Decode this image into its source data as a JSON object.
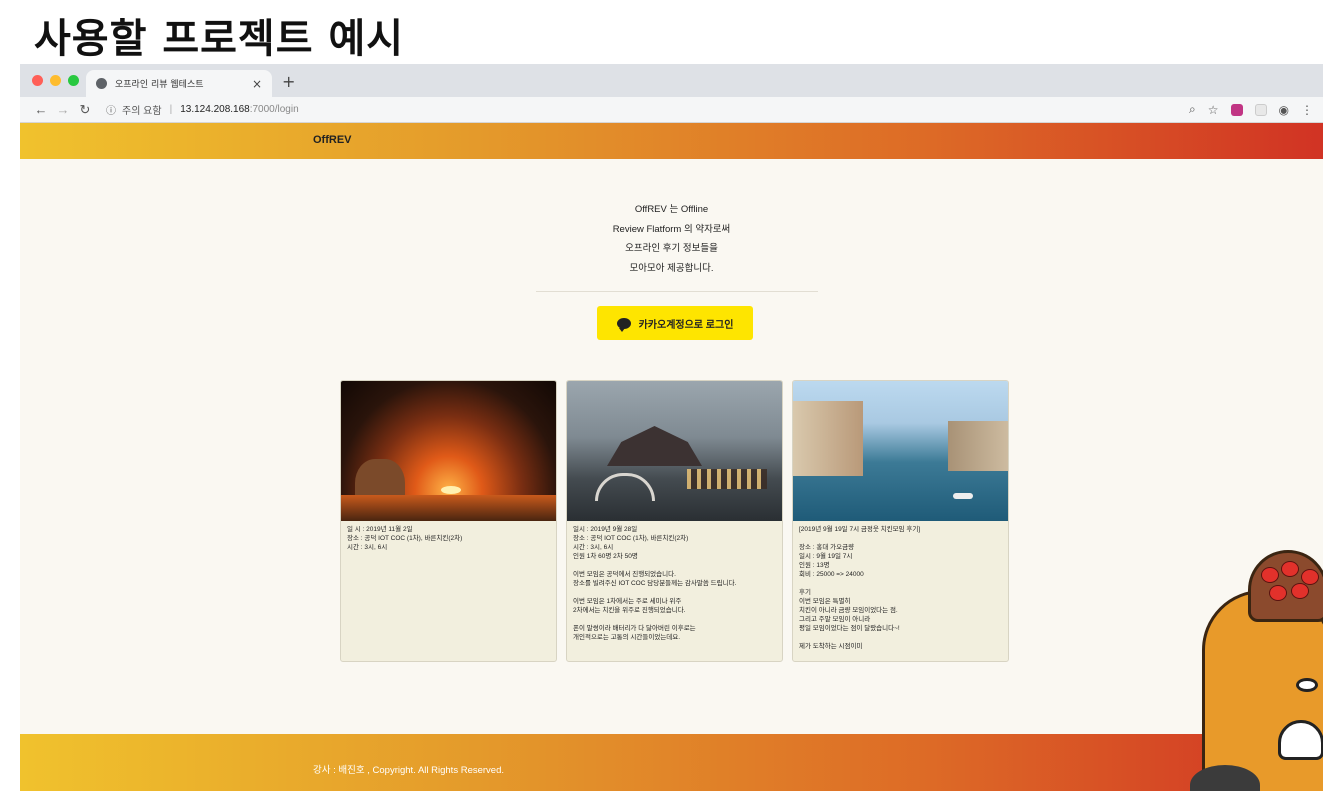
{
  "slide": {
    "title": "사용할 프로젝트 예시"
  },
  "browser": {
    "tab_title": "오프라인 리뷰 웹테스트",
    "tab_close": "×",
    "new_tab": "+",
    "address": {
      "security_label": "주의 요함",
      "separator": "|",
      "host": "13.124.208.168",
      "path": ":7000/login"
    }
  },
  "site": {
    "brand": "OffREV",
    "intro_lines": [
      "OffREV 는 Offline",
      "Review Flatform 의 약자로써",
      "오프라인 후기 정보들을",
      "모아모아 제공합니다."
    ],
    "login_button": "카카오계정으로 로그인",
    "footer": "강사 : 배진호 , Copyright. All Rights Reserved."
  },
  "cards": [
    {
      "lines": [
        "일 시 : 2019년 11월 2일",
        "장소 : 공덕 IOT COC (1차), 바른치킨(2차)",
        "시간 : 3시, 6시"
      ]
    },
    {
      "lines": [
        "일시 : 2019년 9월 28일",
        "장소 : 공덕 IOT COC (1차), 바른치킨(2차)",
        "시간 : 3시, 6시",
        "인원 1차 60명 2차 50명",
        "",
        "이번 모임은 공덕에서 진행되었습니다.",
        "장소를 빌려주신 IOT COC 담당분들께는 감사말씀 드립니다.",
        "",
        "이번 모임은 1차에서는 주로 세미나 위주",
        "2차에서는 치킨을 위주로 진행되었습니다.",
        "",
        "폰이 말썽이라 배터리가 다 닳아버린 이후로는",
        "개인적으로는 고통의 시간들이었는데요."
      ]
    },
    {
      "lines": [
        "[2019년 9월 19일 7시 금정웃 치킨모임 후기]",
        "",
        "장소 : 홍대 가오금량",
        "일시 : 9월 19일 7시",
        "인원 : 13명",
        "회비 : 25000 => 24000",
        "",
        "후기",
        "이번 모임은 특별히",
        "치킨이 아니라 금량 모임이었다는 점.",
        "그리고 주말 모임이 아니라",
        "평일 모임이었다는 점이 달랐습니다~!",
        "",
        "제가 도착하는 시점이미"
      ]
    }
  ],
  "colors": {
    "header_gradient_start": "#f0c22d",
    "header_gradient_end": "#d13324",
    "kakao_yellow": "#fee500",
    "page_background": "#faf8f2",
    "card_background": "#f2efde"
  },
  "icons": {
    "back": "back-arrow-icon",
    "forward": "forward-arrow-icon",
    "reload": "reload-icon",
    "info": "info-icon",
    "zoom": "zoom-icon",
    "bookmark": "star-icon",
    "profile": "profile-icon",
    "menu": "kebab-menu-icon",
    "kakao": "speech-bubble-icon"
  }
}
